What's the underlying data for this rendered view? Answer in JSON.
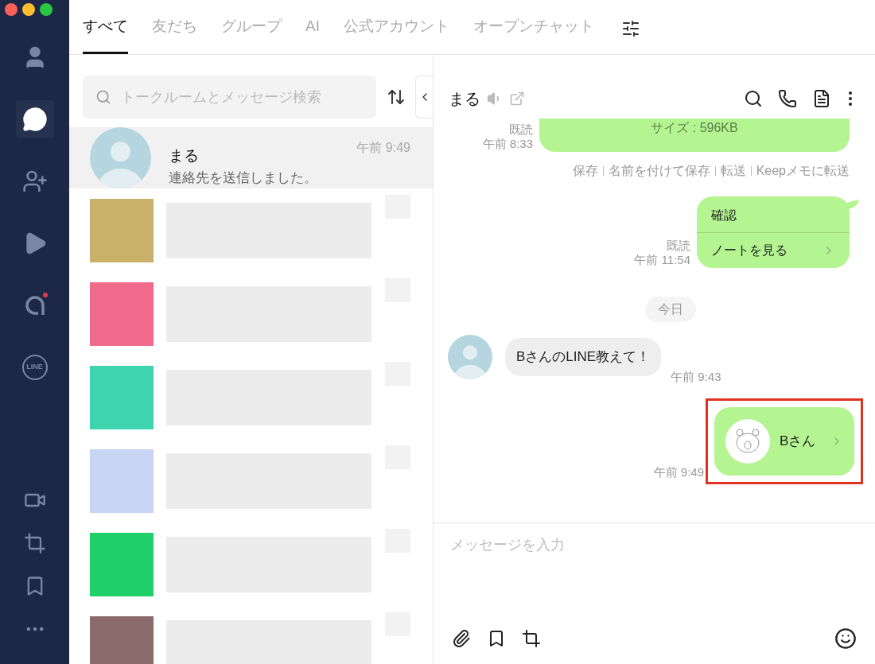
{
  "sidebar": {
    "items": [
      {
        "kind": "person",
        "selected": false
      },
      {
        "kind": "chat",
        "selected": true
      },
      {
        "kind": "add-friend",
        "selected": false
      },
      {
        "kind": "play",
        "selected": false
      },
      {
        "kind": "a",
        "selected": false,
        "badge": true
      },
      {
        "kind": "line",
        "label": "LINE",
        "selected": false
      }
    ],
    "bottom_items": [
      {
        "kind": "video"
      },
      {
        "kind": "crop"
      },
      {
        "kind": "bookmark"
      },
      {
        "kind": "more"
      }
    ]
  },
  "tabs": [
    {
      "label": "すべて",
      "selected": true
    },
    {
      "label": "友だち",
      "selected": false
    },
    {
      "label": "グループ",
      "selected": false
    },
    {
      "label": "AI",
      "selected": false
    },
    {
      "label": "公式アカウント",
      "selected": false
    },
    {
      "label": "オープンチャット",
      "selected": false
    }
  ],
  "search": {
    "placeholder": "トークルームとメッセージ検索"
  },
  "chats": [
    {
      "name": "まる",
      "preview": "連絡先を送信しました。",
      "time": "午前 9:49",
      "selected": true
    }
  ],
  "blurred_chats": [
    {
      "color": "#c9b16a"
    },
    {
      "color": "#f06a8c"
    },
    {
      "color": "#3fd4b0"
    },
    {
      "color": "#c8d4f4"
    },
    {
      "color": "#1fcf6a"
    },
    {
      "color": "#8a6a6a"
    }
  ],
  "chat": {
    "title": "まる",
    "messages": [
      {
        "kind": "file",
        "text": "サイズ : 596KB",
        "read": "既読",
        "time": "午前 8:33"
      },
      {
        "kind": "actions",
        "items": [
          "保存",
          "名前を付けて保存",
          "転送",
          "Keepメモに転送"
        ]
      },
      {
        "kind": "note",
        "title": "確認",
        "link": "ノートを見る",
        "read": "既読",
        "time": "午前 11:54"
      },
      {
        "kind": "date",
        "text": "今日"
      },
      {
        "kind": "received",
        "text": "BさんのLINE教えて！",
        "time": "午前 9:43"
      },
      {
        "kind": "contact",
        "name": "Bさん",
        "time": "午前 9:49",
        "highlighted": true
      }
    ]
  },
  "input": {
    "placeholder": "メッセージを入力"
  }
}
